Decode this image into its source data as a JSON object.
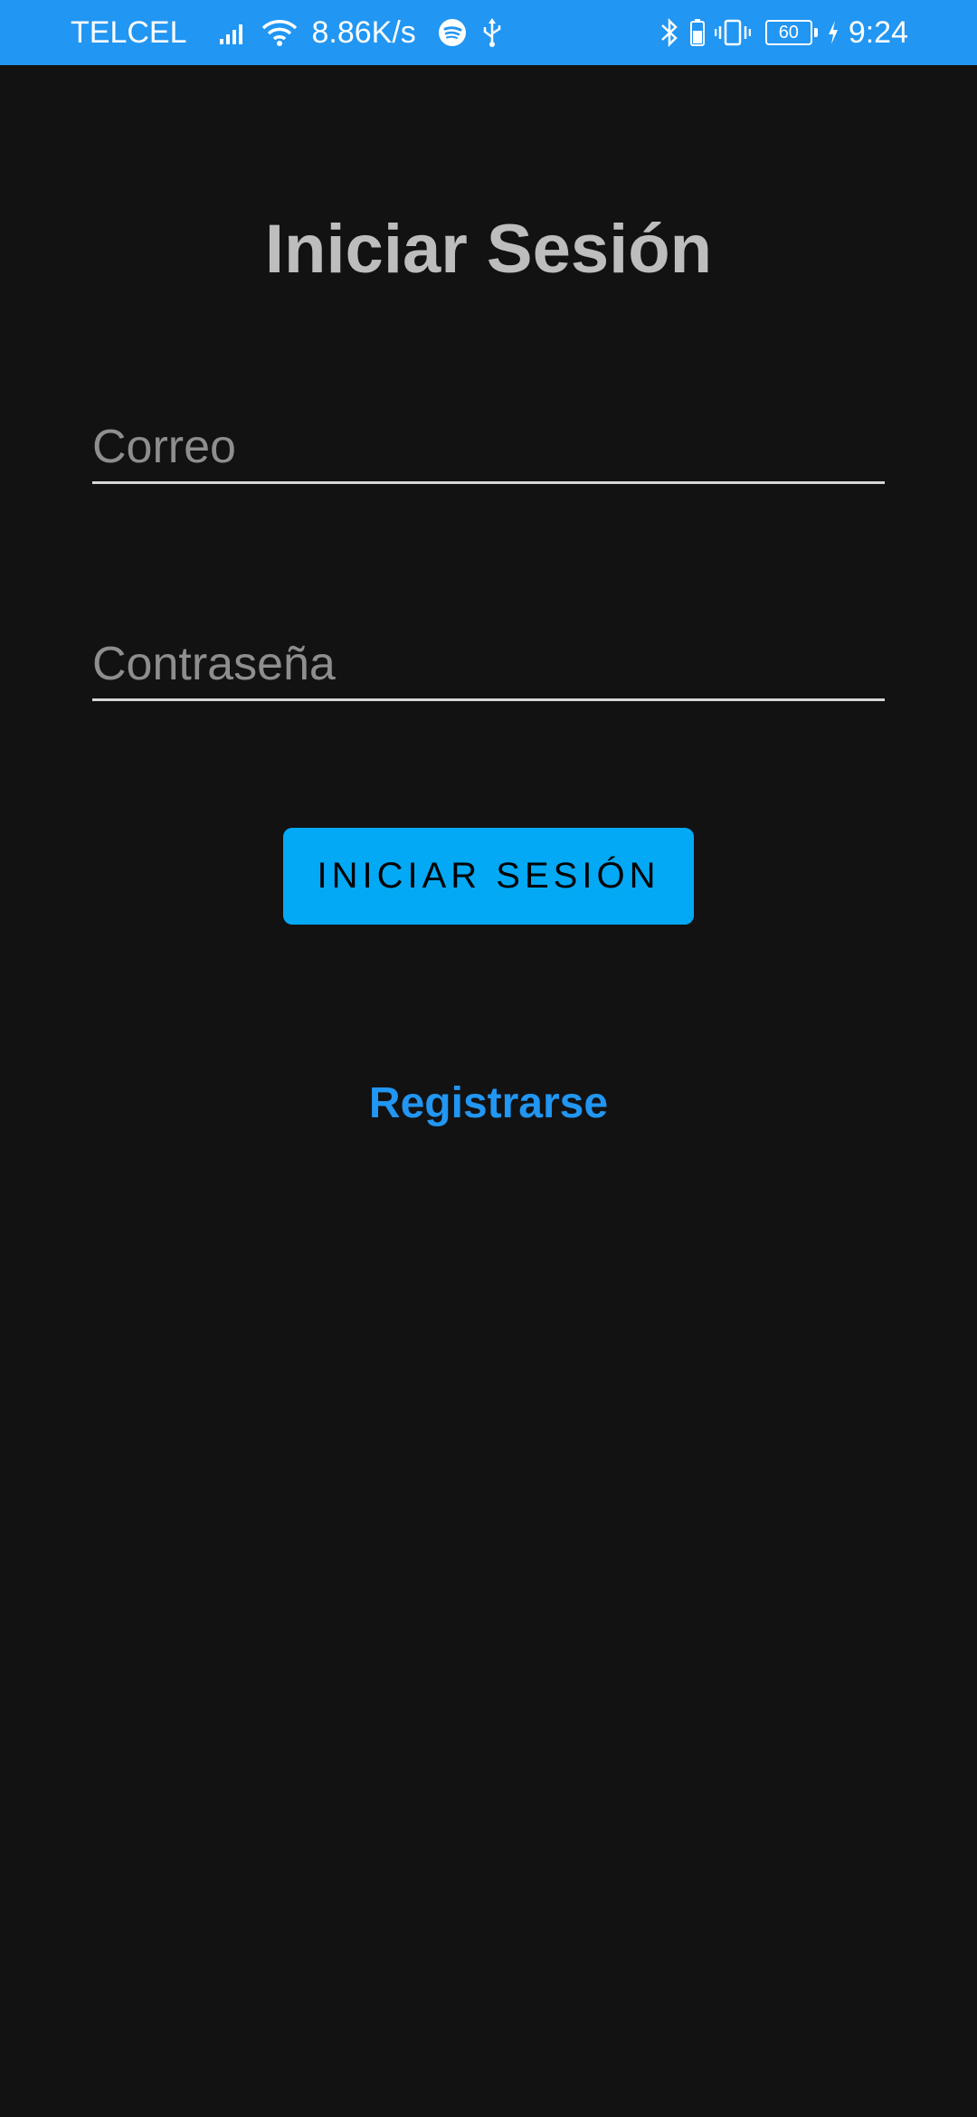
{
  "status_bar": {
    "carrier": "TELCEL",
    "network_speed": "8.86K/s",
    "battery_level": "60",
    "time": "9:24",
    "icons": {
      "signal": "signal-icon",
      "wifi": "wifi-icon",
      "spotify": "spotify-icon",
      "usb": "usb-icon",
      "bluetooth": "bluetooth-icon",
      "vibrate": "vibrate-icon",
      "charging": "charging-icon"
    },
    "background_color": "#2196F3"
  },
  "login": {
    "title": "Iniciar Sesión",
    "email_placeholder": "Correo",
    "email_value": "",
    "password_placeholder": "Contraseña",
    "password_value": "",
    "submit_label": "INICIAR SESIÓN",
    "register_label": "Registrarse"
  },
  "colors": {
    "background": "#121212",
    "button": "#03A9F4",
    "link": "#2196F3",
    "title": "#BDBDBD"
  }
}
